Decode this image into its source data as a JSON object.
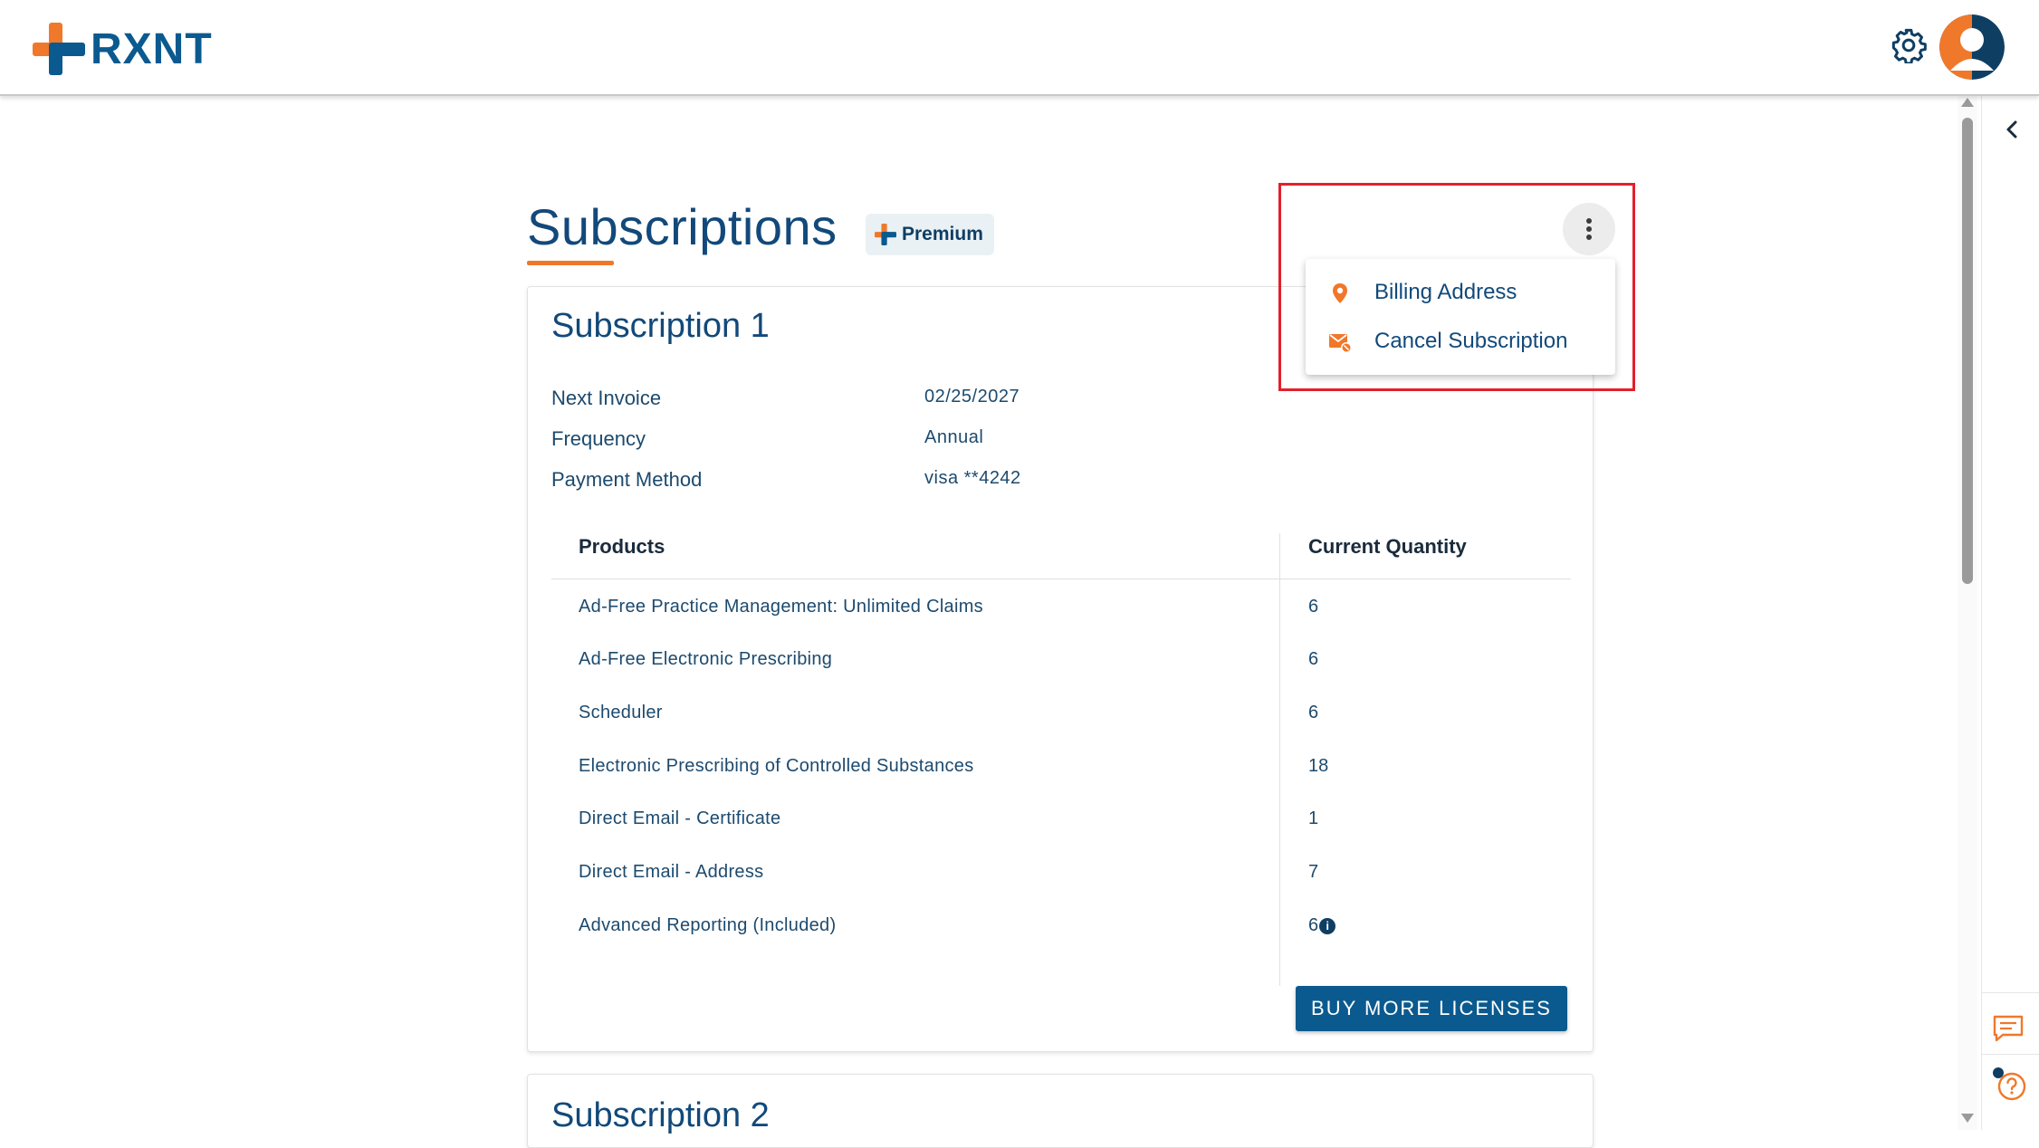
{
  "header": {
    "logo_text": "RXNT",
    "icons": {
      "settings": "gear-icon",
      "avatar": "user-avatar-icon"
    }
  },
  "page": {
    "title": "Subscriptions",
    "badge": "Premium"
  },
  "menu": {
    "items": [
      {
        "label": "Billing Address",
        "icon": "location-pin-icon"
      },
      {
        "label": "Cancel Subscription",
        "icon": "mail-cancel-icon"
      }
    ]
  },
  "subscription1": {
    "title": "Subscription 1",
    "details": [
      {
        "label": "Next Invoice",
        "value": "02/25/2027"
      },
      {
        "label": "Frequency",
        "value": "Annual"
      },
      {
        "label": "Payment Method",
        "value": "visa **4242"
      }
    ],
    "table": {
      "headers": [
        "Products",
        "Current Quantity"
      ],
      "rows": [
        {
          "name": "Ad-Free Practice Management: Unlimited Claims",
          "qty": "6"
        },
        {
          "name": "Ad-Free Electronic Prescribing",
          "qty": "6"
        },
        {
          "name": "Scheduler",
          "qty": "6"
        },
        {
          "name": "Electronic Prescribing of Controlled Substances",
          "qty": "18"
        },
        {
          "name": "Direct Email - Certificate",
          "qty": "1"
        },
        {
          "name": "Direct Email - Address",
          "qty": "7"
        },
        {
          "name": "Advanced Reporting (Included)",
          "qty": "6"
        }
      ]
    },
    "buy_button": "BUY MORE LICENSES"
  },
  "subscription2": {
    "title": "Subscription 2"
  },
  "colors": {
    "brand_blue": "#0b5a8f",
    "brand_orange": "#f0782a",
    "highlight_red": "#e3202a"
  }
}
